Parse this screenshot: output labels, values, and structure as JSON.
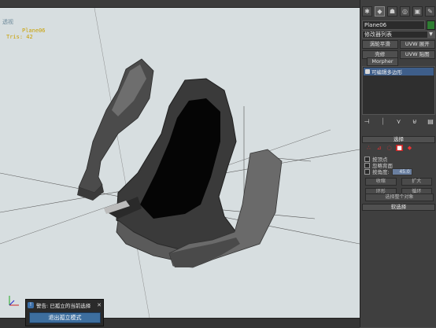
{
  "viewport": {
    "label": "透视",
    "object_name": "Plane06",
    "object_info": "Tris: 42",
    "background_color": "#d7dee0"
  },
  "panel": {
    "tabs": [
      "create-icon",
      "modify-icon",
      "hierarchy-icon",
      "motion-icon",
      "display-icon",
      "utilities-icon"
    ],
    "object_name": "Plane06",
    "object_color": "#2e7d32",
    "modifier_list": "修改器列表",
    "buttons": [
      "涡轮平滑",
      "UVW 展开",
      "壳修",
      "UVW 贴图"
    ],
    "morpher_label": "Morpher",
    "stack_item": "可编辑多边形",
    "selection_rollout": "选择",
    "checkboxes": [
      "按顶点",
      "忽略背面",
      "按角度:"
    ],
    "angle_value": "45.0",
    "small_buttons": [
      "收缩",
      "扩大",
      "环形",
      "循环"
    ],
    "wide_button": "选择整个对象",
    "soft_selection_rollout": "软选择",
    "accent_color": "#3e5e8a"
  },
  "notification": {
    "message": "警告: 已孤立的当前选择",
    "close_glyph": "✕",
    "exit_button": "退出孤立模式"
  }
}
